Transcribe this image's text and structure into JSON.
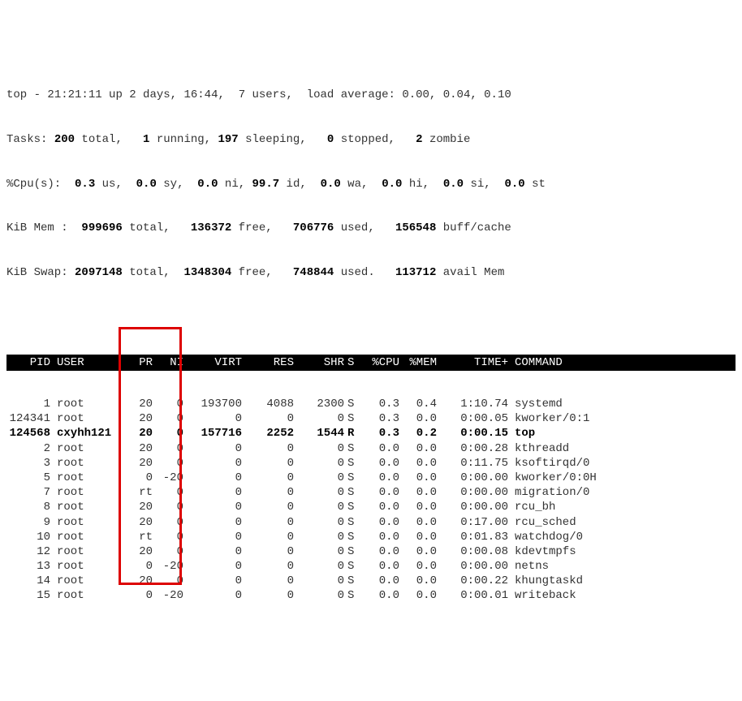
{
  "summary": {
    "line1": {
      "prefix": "top - ",
      "time": "21:21:11",
      "up_label": " up ",
      "uptime": "2 days, 16:44",
      "users_sep": ",  ",
      "users": "7 users",
      "load_label": ",  load average: ",
      "load": "0.00, 0.04, 0.10"
    },
    "line2": {
      "prefix": "Tasks: ",
      "total": "200",
      "total_label": " total,   ",
      "running": "1",
      "running_label": " running, ",
      "sleeping": "197",
      "sleeping_label": " sleeping,   ",
      "stopped": "0",
      "stopped_label": " stopped,   ",
      "zombie": "2",
      "zombie_label": " zombie"
    },
    "line3": {
      "prefix": "%Cpu(s):  ",
      "us": "0.3",
      "us_label": " us,  ",
      "sy": "0.0",
      "sy_label": " sy,  ",
      "ni": "0.0",
      "ni_label": " ni, ",
      "id": "99.7",
      "id_label": " id,  ",
      "wa": "0.0",
      "wa_label": " wa,  ",
      "hi": "0.0",
      "hi_label": " hi,  ",
      "si": "0.0",
      "si_label": " si,  ",
      "st": "0.0",
      "st_label": " st"
    },
    "line4": {
      "prefix": "KiB Mem :  ",
      "total": "999696",
      "total_label": " total,   ",
      "free": "136372",
      "free_label": " free,   ",
      "used": "706776",
      "used_label": " used,   ",
      "buff": "156548",
      "buff_label": " buff/cache"
    },
    "line5": {
      "prefix": "KiB Swap: ",
      "total": "2097148",
      "total_label": " total,  ",
      "free": "1348304",
      "free_label": " free,   ",
      "used": "748844",
      "used_label": " used.   ",
      "avail": "113712",
      "avail_label": " avail Mem"
    }
  },
  "headers": {
    "pid": "PID",
    "user": "USER",
    "pr": "PR",
    "ni": "NI",
    "virt": "VIRT",
    "res": "RES",
    "shr": "SHR",
    "s": "S",
    "cpu": "%CPU",
    "mem": "%MEM",
    "time": "TIME+",
    "cmd": "COMMAND"
  },
  "processes": [
    {
      "pid": "1",
      "user": "root",
      "pr": "20",
      "ni": "0",
      "virt": "193700",
      "res": "4088",
      "shr": "2300",
      "s": "S",
      "cpu": "0.3",
      "mem": "0.4",
      "time": "1:10.74",
      "cmd": "systemd",
      "bold": false
    },
    {
      "pid": "124341",
      "user": "root",
      "pr": "20",
      "ni": "0",
      "virt": "0",
      "res": "0",
      "shr": "0",
      "s": "S",
      "cpu": "0.3",
      "mem": "0.0",
      "time": "0:00.05",
      "cmd": "kworker/0:1",
      "bold": false
    },
    {
      "pid": "124568",
      "user": "cxyhh121",
      "pr": "20",
      "ni": "0",
      "virt": "157716",
      "res": "2252",
      "shr": "1544",
      "s": "R",
      "cpu": "0.3",
      "mem": "0.2",
      "time": "0:00.15",
      "cmd": "top",
      "bold": true
    },
    {
      "pid": "2",
      "user": "root",
      "pr": "20",
      "ni": "0",
      "virt": "0",
      "res": "0",
      "shr": "0",
      "s": "S",
      "cpu": "0.0",
      "mem": "0.0",
      "time": "0:00.28",
      "cmd": "kthreadd",
      "bold": false
    },
    {
      "pid": "3",
      "user": "root",
      "pr": "20",
      "ni": "0",
      "virt": "0",
      "res": "0",
      "shr": "0",
      "s": "S",
      "cpu": "0.0",
      "mem": "0.0",
      "time": "0:11.75",
      "cmd": "ksoftirqd/0",
      "bold": false
    },
    {
      "pid": "5",
      "user": "root",
      "pr": "0",
      "ni": "-20",
      "virt": "0",
      "res": "0",
      "shr": "0",
      "s": "S",
      "cpu": "0.0",
      "mem": "0.0",
      "time": "0:00.00",
      "cmd": "kworker/0:0H",
      "bold": false
    },
    {
      "pid": "7",
      "user": "root",
      "pr": "rt",
      "ni": "0",
      "virt": "0",
      "res": "0",
      "shr": "0",
      "s": "S",
      "cpu": "0.0",
      "mem": "0.0",
      "time": "0:00.00",
      "cmd": "migration/0",
      "bold": false
    },
    {
      "pid": "8",
      "user": "root",
      "pr": "20",
      "ni": "0",
      "virt": "0",
      "res": "0",
      "shr": "0",
      "s": "S",
      "cpu": "0.0",
      "mem": "0.0",
      "time": "0:00.00",
      "cmd": "rcu_bh",
      "bold": false
    },
    {
      "pid": "9",
      "user": "root",
      "pr": "20",
      "ni": "0",
      "virt": "0",
      "res": "0",
      "shr": "0",
      "s": "S",
      "cpu": "0.0",
      "mem": "0.0",
      "time": "0:17.00",
      "cmd": "rcu_sched",
      "bold": false
    },
    {
      "pid": "10",
      "user": "root",
      "pr": "rt",
      "ni": "0",
      "virt": "0",
      "res": "0",
      "shr": "0",
      "s": "S",
      "cpu": "0.0",
      "mem": "0.0",
      "time": "0:01.83",
      "cmd": "watchdog/0",
      "bold": false
    },
    {
      "pid": "12",
      "user": "root",
      "pr": "20",
      "ni": "0",
      "virt": "0",
      "res": "0",
      "shr": "0",
      "s": "S",
      "cpu": "0.0",
      "mem": "0.0",
      "time": "0:00.08",
      "cmd": "kdevtmpfs",
      "bold": false
    },
    {
      "pid": "13",
      "user": "root",
      "pr": "0",
      "ni": "-20",
      "virt": "0",
      "res": "0",
      "shr": "0",
      "s": "S",
      "cpu": "0.0",
      "mem": "0.0",
      "time": "0:00.00",
      "cmd": "netns",
      "bold": false
    },
    {
      "pid": "14",
      "user": "root",
      "pr": "20",
      "ni": "0",
      "virt": "0",
      "res": "0",
      "shr": "0",
      "s": "S",
      "cpu": "0.0",
      "mem": "0.0",
      "time": "0:00.22",
      "cmd": "khungtaskd",
      "bold": false
    },
    {
      "pid": "15",
      "user": "root",
      "pr": "0",
      "ni": "-20",
      "virt": "0",
      "res": "0",
      "shr": "0",
      "s": "S",
      "cpu": "0.0",
      "mem": "0.0",
      "time": "0:00.01",
      "cmd": "writeback",
      "bold": false
    }
  ]
}
